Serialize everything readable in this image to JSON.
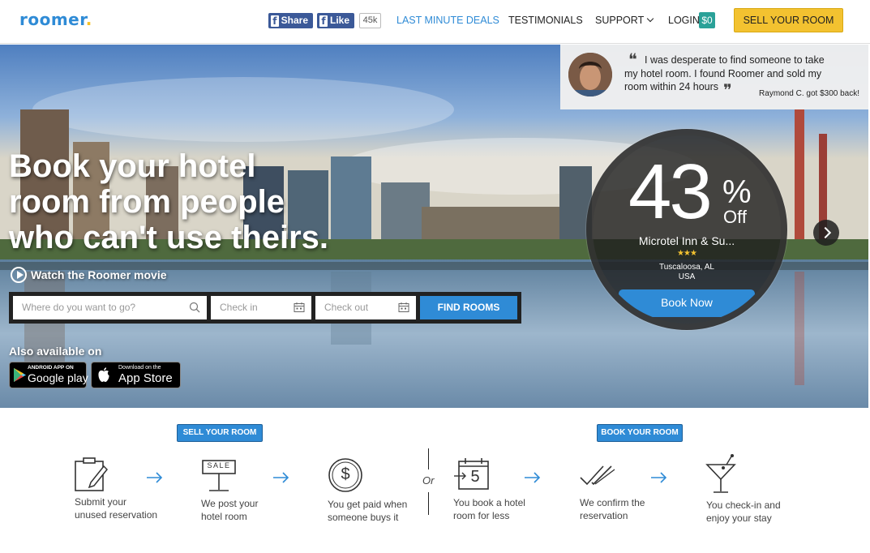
{
  "brand": {
    "logo_text": "roomer",
    "logo_dot": ".",
    "accent": "#2f8bd6",
    "gold": "#f3c230"
  },
  "header": {
    "fb_share_label": "Share",
    "fb_like_label": "Like",
    "fb_like_count": "45k",
    "nav_deals": "LAST MINUTE DEALS",
    "nav_testimonials": "TESTIMONIALS",
    "nav_support": "SUPPORT",
    "nav_login": "LOGIN",
    "balance": "$0",
    "sell_button": "SELL YOUR ROOM"
  },
  "testimonial": {
    "quote": "I was desperate to find someone to take my hotel room. I found Roomer and sold my room within 24 hours",
    "attribution": "Raymond C. got $300 back!"
  },
  "hero": {
    "headline_1": "Book your hotel",
    "headline_2": "room from people",
    "headline_3": "who can't use theirs.",
    "watch_movie": "Watch the Roomer movie",
    "also_available": "Also available on"
  },
  "search": {
    "where_placeholder": "Where do you want to go?",
    "checkin_placeholder": "Check in",
    "checkout_placeholder": "Check out",
    "find_button": "FIND ROOMS"
  },
  "stores": {
    "google_small": "ANDROID APP ON",
    "google_big": "Google play",
    "apple_small": "Download on the",
    "apple_big": "App Store"
  },
  "deal": {
    "percent": "43",
    "percent_sign": "%",
    "off_label": "Off",
    "hotel_name": "Microtel Inn & Su...",
    "stars": "★★★",
    "star_rating": 2.5,
    "city": "Tuscaloosa, AL",
    "country": "USA",
    "book_button": "Book Now"
  },
  "how_it_works": {
    "sell_tag": "SELL YOUR ROOM",
    "book_tag": "BOOK YOUR ROOM",
    "or_label": "Or",
    "steps": [
      {
        "line1": "Submit your",
        "line2": "unused reservation",
        "icon": "clipboard-icon"
      },
      {
        "line1": "We post your",
        "line2": "hotel room",
        "icon": "sale-sign-icon",
        "sign_text": "SALE"
      },
      {
        "line1": "You get paid when",
        "line2": "someone buys it",
        "icon": "dollar-coin-icon",
        "symbol": "$"
      },
      {
        "line1": "You book a hotel",
        "line2": "room for less",
        "icon": "calendar-icon",
        "calendar_number": "5"
      },
      {
        "line1": "We confirm the",
        "line2": "reservation",
        "icon": "double-check-icon"
      },
      {
        "line1": "You check-in and",
        "line2": "enjoy your stay",
        "icon": "cocktail-icon"
      }
    ]
  }
}
